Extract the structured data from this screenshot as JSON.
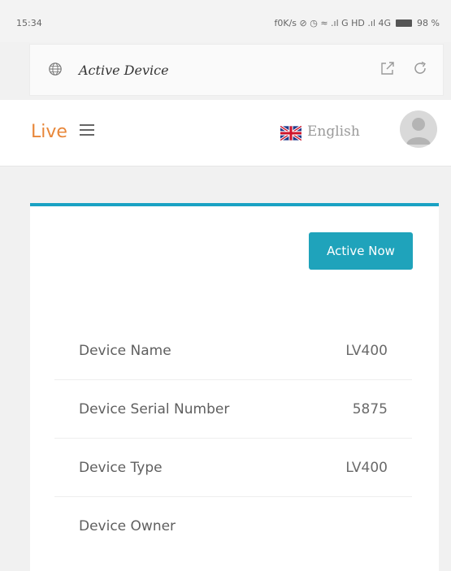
{
  "status_bar": {
    "time": "15:34",
    "indicators": "f0K/s ⊘ ◷ ≈ .ıl G HD .ıl 4G",
    "battery": "98 %"
  },
  "browser": {
    "page_title": "Active Device",
    "icons": [
      "globe-icon",
      "share-icon",
      "reload-icon"
    ]
  },
  "header": {
    "logo": "Live",
    "language": "English",
    "icons": [
      "menu-icon",
      "uk-flag-icon",
      "user-avatar-icon"
    ]
  },
  "card": {
    "button_label": "Active Now",
    "details": [
      {
        "label": "Device Name",
        "value": "LV400"
      },
      {
        "label": "Device Serial Number",
        "value": "5875"
      },
      {
        "label": "Device Type",
        "value": "LV400"
      },
      {
        "label": "Device Owner",
        "value": ""
      }
    ]
  },
  "colors": {
    "accent": "#1aa2c3",
    "button": "#1fa3bb",
    "logo": "#e8873a"
  }
}
